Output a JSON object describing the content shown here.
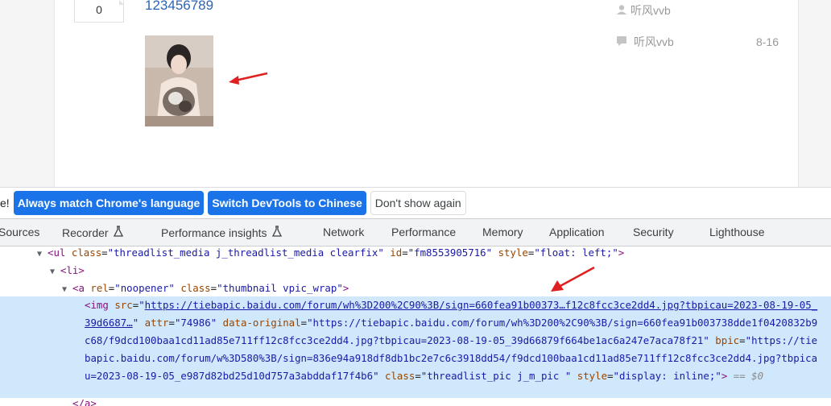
{
  "post": {
    "reply_count": "0",
    "title": "123456789",
    "author": "听风vvb",
    "last_reply_user": "听风vvb",
    "last_reply_date": "8-16"
  },
  "infobar": {
    "trailing_text": "e!",
    "match_button": "Always match Chrome's language",
    "switch_button": "Switch DevTools to Chinese",
    "dismiss_button": "Don't show again"
  },
  "tabs": [
    {
      "label": "Sources"
    },
    {
      "label": "Recorder"
    },
    {
      "label": "Performance insights"
    },
    {
      "label": "Network"
    },
    {
      "label": "Performance"
    },
    {
      "label": "Memory"
    },
    {
      "label": "Application"
    },
    {
      "label": "Security"
    },
    {
      "label": "Lighthouse"
    }
  ],
  "elements": {
    "ul_tag": "ul",
    "ul_class_val": "\"threadlist_media j_threadlist_media clearfix\"",
    "ul_id_val": "\"fm8553905716\"",
    "ul_style_val": "\"float: left;\"",
    "li_tag": "li",
    "a_tag": "a",
    "a_rel_val": "\"noopener\"",
    "a_class_val": "\"thumbnail vpic_wrap\"",
    "img_tag": "img",
    "img_src": "https://tiebapic.baidu.com/forum/wh%3D200%2C90%3B/sign=660fea91b00373…f12c8fcc3ce2dd4.jpg?tbpicau=2023-08-19-05_39d6687…",
    "img_attr_val": "\"74986\"",
    "img_data_original": "\"https://tiebapic.baidu.com/forum/wh%3D200%2C90%3B/sign=660fea91b003738dde1f0420832b9c68/f9dcd100baa1cd11ad85e711ff12c8fcc3ce2dd4.jpg?tbpicau=2023-08-19-05_39d66879f664be1ac6a247e7aca78f21\"",
    "img_bpic": "\"https://tiebapic.baidu.com/forum/w%3D580%3B/sign=836e94a918df8db1bc2e7c6c3918dd54/f9dcd100baa1cd11ad85e711ff12c8fcc3ce2dd4.jpg?tbpicau=2023-08-19-05_e987d82bd25d10d757a3abddaf17f4b6\"",
    "img_class_val": "\"threadlist_pic j_m_pic \"",
    "img_style_val": "\"display: inline;\"",
    "selected_marker": "== $0",
    "closing_a": "</a>"
  },
  "colors": {
    "link_blue": "#2d64b3",
    "devtools_button": "#1a73e8",
    "selected_row": "#cfe8fc",
    "arrow_red": "#e02020"
  }
}
